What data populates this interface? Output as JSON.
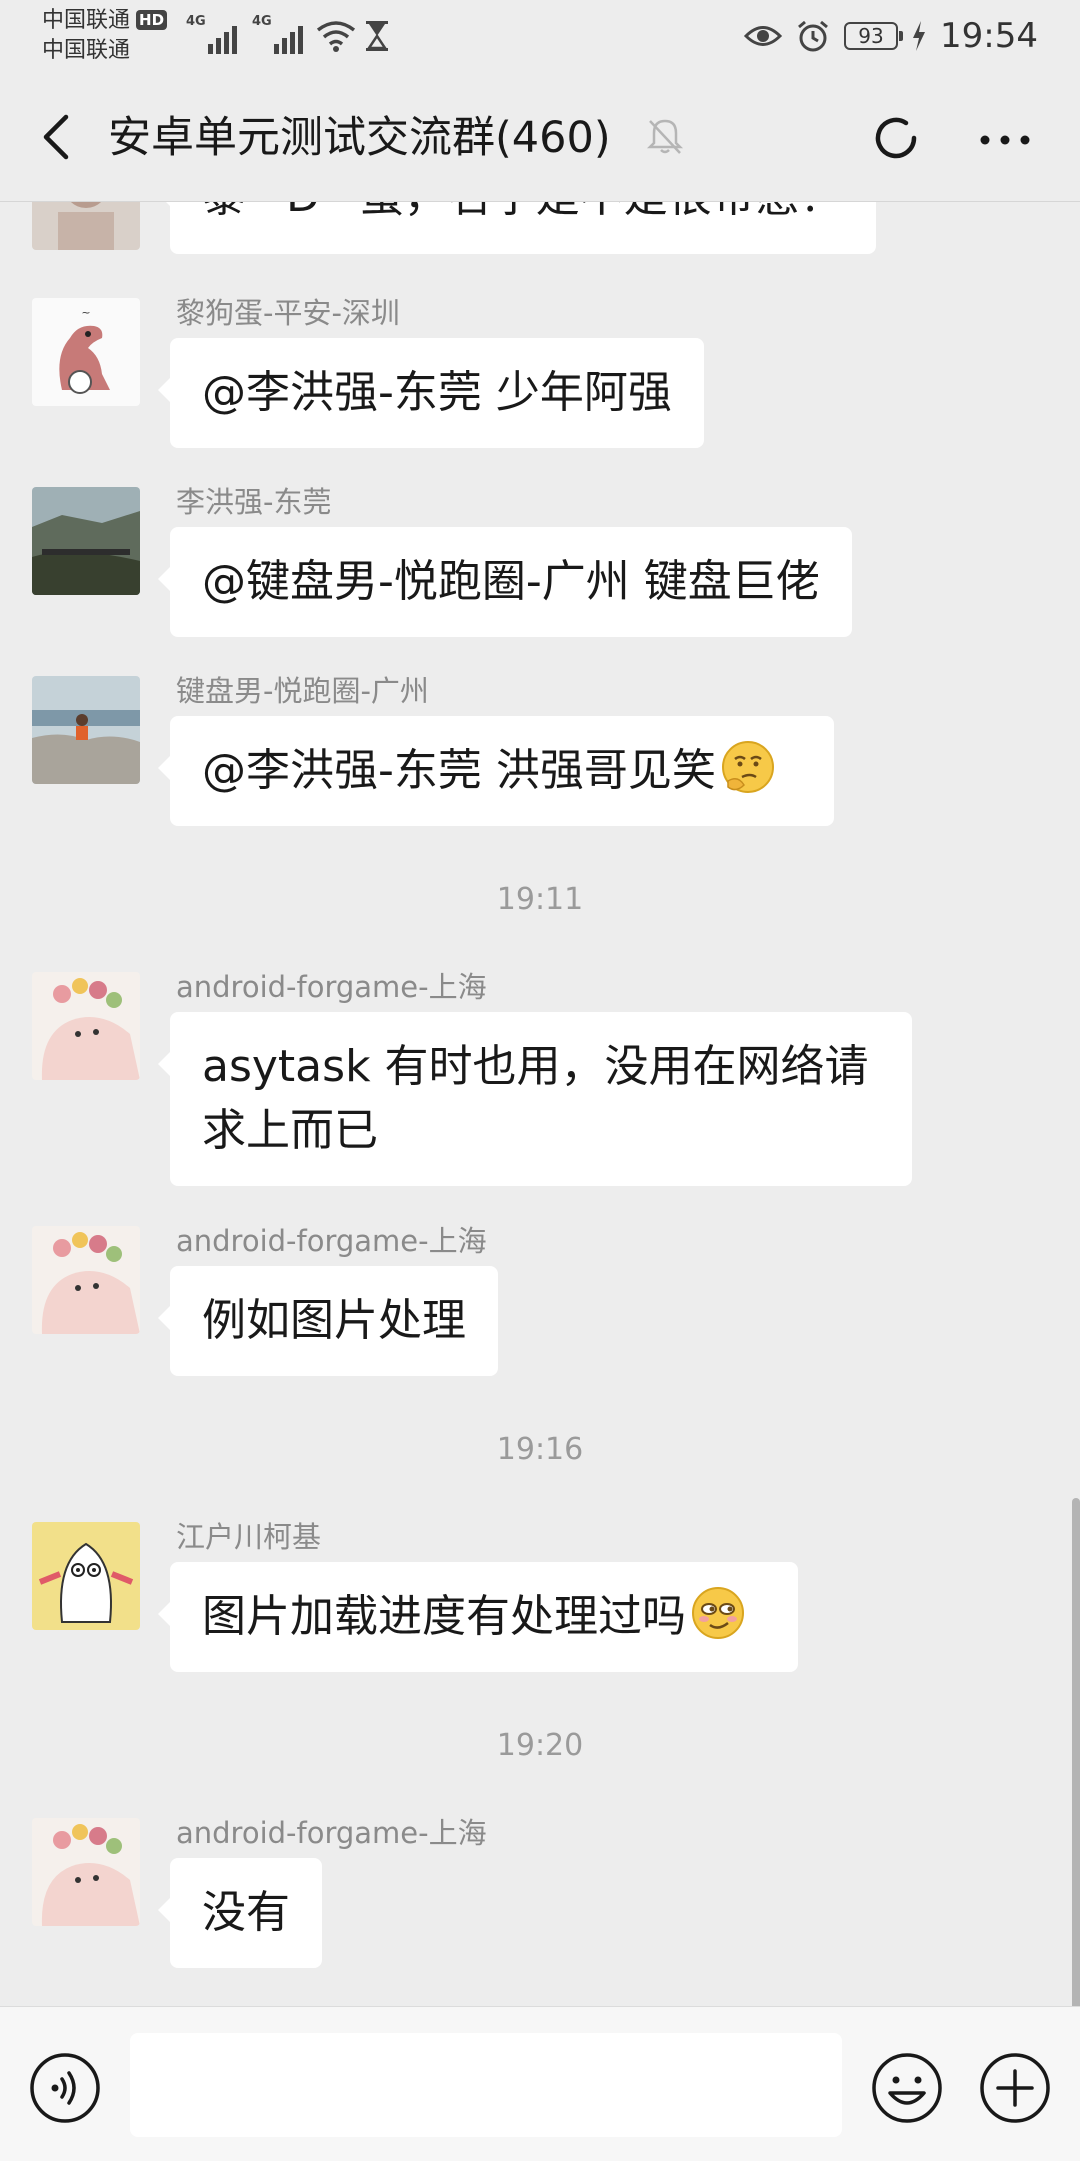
{
  "status_bar": {
    "carrier_1": "中国联通",
    "carrier_2": "中国联通",
    "hd": "HD",
    "net_1": "4G",
    "net_2": "4G",
    "battery": "93",
    "time": "19:54"
  },
  "header": {
    "title": "安卓单元测试交流群(460)"
  },
  "messages": [
    {
      "sender": "",
      "text": "黎 •D• 蛋，名字是不是很带感？"
    },
    {
      "sender": "黎狗蛋-平安-深圳",
      "text": "@李洪强-东莞 少年阿强"
    },
    {
      "sender": "李洪强-东莞",
      "text": "@键盘男-悦跑圈-广州 键盘巨佬"
    },
    {
      "sender": "键盘男-悦跑圈-广州",
      "text": "@李洪强-东莞  洪强哥见笑"
    },
    {
      "sender": "android-forgame-上海",
      "text": "asytask 有时也用，没用在网络请求上而已"
    },
    {
      "sender": "android-forgame-上海",
      "text": "例如图片处理"
    },
    {
      "sender": "江户川柯基",
      "text": "图片加载进度有处理过吗"
    },
    {
      "sender": "android-forgame-上海",
      "text": "没有"
    }
  ],
  "timestamps": [
    "19:11",
    "19:16",
    "19:20"
  ],
  "icons": {
    "back": "back-arrow-icon",
    "mute": "mute-bell-icon",
    "refresh": "refresh-icon",
    "more": "more-icon",
    "voice": "voice-icon",
    "emoji": "emoji-icon",
    "plus": "plus-icon"
  },
  "colors": {
    "background": "#ededed",
    "bubble": "#ffffff",
    "sender_name": "#8a8a8a",
    "timestamp": "#9a9a9a"
  }
}
